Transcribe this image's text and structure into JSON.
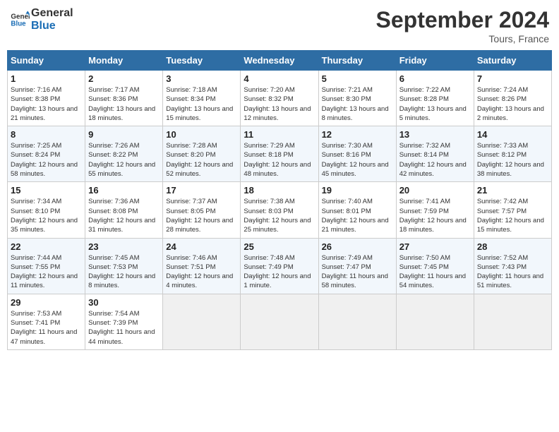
{
  "logo": {
    "line1": "General",
    "line2": "Blue"
  },
  "title": "September 2024",
  "location": "Tours, France",
  "days_header": [
    "Sunday",
    "Monday",
    "Tuesday",
    "Wednesday",
    "Thursday",
    "Friday",
    "Saturday"
  ],
  "weeks": [
    [
      {
        "num": "1",
        "sunrise": "Sunrise: 7:16 AM",
        "sunset": "Sunset: 8:38 PM",
        "daylight": "Daylight: 13 hours and 21 minutes."
      },
      {
        "num": "2",
        "sunrise": "Sunrise: 7:17 AM",
        "sunset": "Sunset: 8:36 PM",
        "daylight": "Daylight: 13 hours and 18 minutes."
      },
      {
        "num": "3",
        "sunrise": "Sunrise: 7:18 AM",
        "sunset": "Sunset: 8:34 PM",
        "daylight": "Daylight: 13 hours and 15 minutes."
      },
      {
        "num": "4",
        "sunrise": "Sunrise: 7:20 AM",
        "sunset": "Sunset: 8:32 PM",
        "daylight": "Daylight: 13 hours and 12 minutes."
      },
      {
        "num": "5",
        "sunrise": "Sunrise: 7:21 AM",
        "sunset": "Sunset: 8:30 PM",
        "daylight": "Daylight: 13 hours and 8 minutes."
      },
      {
        "num": "6",
        "sunrise": "Sunrise: 7:22 AM",
        "sunset": "Sunset: 8:28 PM",
        "daylight": "Daylight: 13 hours and 5 minutes."
      },
      {
        "num": "7",
        "sunrise": "Sunrise: 7:24 AM",
        "sunset": "Sunset: 8:26 PM",
        "daylight": "Daylight: 13 hours and 2 minutes."
      }
    ],
    [
      {
        "num": "8",
        "sunrise": "Sunrise: 7:25 AM",
        "sunset": "Sunset: 8:24 PM",
        "daylight": "Daylight: 12 hours and 58 minutes."
      },
      {
        "num": "9",
        "sunrise": "Sunrise: 7:26 AM",
        "sunset": "Sunset: 8:22 PM",
        "daylight": "Daylight: 12 hours and 55 minutes."
      },
      {
        "num": "10",
        "sunrise": "Sunrise: 7:28 AM",
        "sunset": "Sunset: 8:20 PM",
        "daylight": "Daylight: 12 hours and 52 minutes."
      },
      {
        "num": "11",
        "sunrise": "Sunrise: 7:29 AM",
        "sunset": "Sunset: 8:18 PM",
        "daylight": "Daylight: 12 hours and 48 minutes."
      },
      {
        "num": "12",
        "sunrise": "Sunrise: 7:30 AM",
        "sunset": "Sunset: 8:16 PM",
        "daylight": "Daylight: 12 hours and 45 minutes."
      },
      {
        "num": "13",
        "sunrise": "Sunrise: 7:32 AM",
        "sunset": "Sunset: 8:14 PM",
        "daylight": "Daylight: 12 hours and 42 minutes."
      },
      {
        "num": "14",
        "sunrise": "Sunrise: 7:33 AM",
        "sunset": "Sunset: 8:12 PM",
        "daylight": "Daylight: 12 hours and 38 minutes."
      }
    ],
    [
      {
        "num": "15",
        "sunrise": "Sunrise: 7:34 AM",
        "sunset": "Sunset: 8:10 PM",
        "daylight": "Daylight: 12 hours and 35 minutes."
      },
      {
        "num": "16",
        "sunrise": "Sunrise: 7:36 AM",
        "sunset": "Sunset: 8:08 PM",
        "daylight": "Daylight: 12 hours and 31 minutes."
      },
      {
        "num": "17",
        "sunrise": "Sunrise: 7:37 AM",
        "sunset": "Sunset: 8:05 PM",
        "daylight": "Daylight: 12 hours and 28 minutes."
      },
      {
        "num": "18",
        "sunrise": "Sunrise: 7:38 AM",
        "sunset": "Sunset: 8:03 PM",
        "daylight": "Daylight: 12 hours and 25 minutes."
      },
      {
        "num": "19",
        "sunrise": "Sunrise: 7:40 AM",
        "sunset": "Sunset: 8:01 PM",
        "daylight": "Daylight: 12 hours and 21 minutes."
      },
      {
        "num": "20",
        "sunrise": "Sunrise: 7:41 AM",
        "sunset": "Sunset: 7:59 PM",
        "daylight": "Daylight: 12 hours and 18 minutes."
      },
      {
        "num": "21",
        "sunrise": "Sunrise: 7:42 AM",
        "sunset": "Sunset: 7:57 PM",
        "daylight": "Daylight: 12 hours and 15 minutes."
      }
    ],
    [
      {
        "num": "22",
        "sunrise": "Sunrise: 7:44 AM",
        "sunset": "Sunset: 7:55 PM",
        "daylight": "Daylight: 12 hours and 11 minutes."
      },
      {
        "num": "23",
        "sunrise": "Sunrise: 7:45 AM",
        "sunset": "Sunset: 7:53 PM",
        "daylight": "Daylight: 12 hours and 8 minutes."
      },
      {
        "num": "24",
        "sunrise": "Sunrise: 7:46 AM",
        "sunset": "Sunset: 7:51 PM",
        "daylight": "Daylight: 12 hours and 4 minutes."
      },
      {
        "num": "25",
        "sunrise": "Sunrise: 7:48 AM",
        "sunset": "Sunset: 7:49 PM",
        "daylight": "Daylight: 12 hours and 1 minute."
      },
      {
        "num": "26",
        "sunrise": "Sunrise: 7:49 AM",
        "sunset": "Sunset: 7:47 PM",
        "daylight": "Daylight: 11 hours and 58 minutes."
      },
      {
        "num": "27",
        "sunrise": "Sunrise: 7:50 AM",
        "sunset": "Sunset: 7:45 PM",
        "daylight": "Daylight: 11 hours and 54 minutes."
      },
      {
        "num": "28",
        "sunrise": "Sunrise: 7:52 AM",
        "sunset": "Sunset: 7:43 PM",
        "daylight": "Daylight: 11 hours and 51 minutes."
      }
    ],
    [
      {
        "num": "29",
        "sunrise": "Sunrise: 7:53 AM",
        "sunset": "Sunset: 7:41 PM",
        "daylight": "Daylight: 11 hours and 47 minutes."
      },
      {
        "num": "30",
        "sunrise": "Sunrise: 7:54 AM",
        "sunset": "Sunset: 7:39 PM",
        "daylight": "Daylight: 11 hours and 44 minutes."
      },
      null,
      null,
      null,
      null,
      null
    ]
  ]
}
